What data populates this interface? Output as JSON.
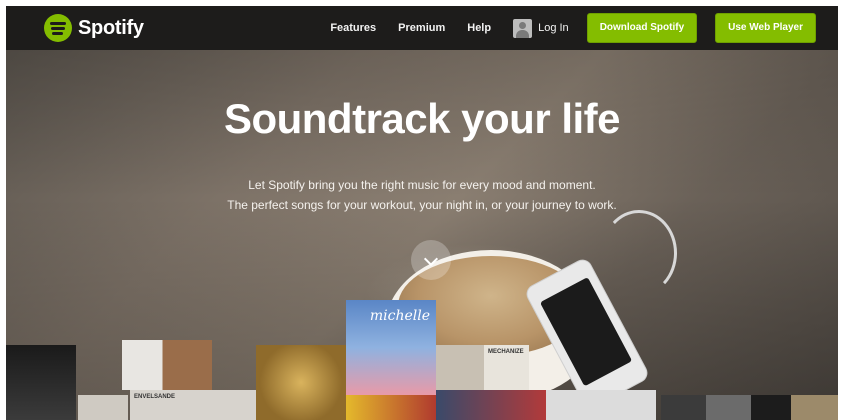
{
  "brand": {
    "name": "Spotify",
    "accent": "#84bd00"
  },
  "nav": {
    "links": [
      "Features",
      "Premium",
      "Help"
    ],
    "login_label": "Log In",
    "download_label": "Download Spotify",
    "webplayer_label": "Use Web Player"
  },
  "hero": {
    "headline": "Soundtrack your life",
    "line1": "Let Spotify bring you the right music for every mood and moment.",
    "line2": "The perfect songs for your workout, your night in, or your journey to work."
  },
  "albums": {
    "michelle": "michelle",
    "ellsande": "ENVELSANDE",
    "mechelte": "MECHANIZE"
  },
  "icons": {
    "logo": "spotify-logo-icon",
    "login": "user-avatar-icon",
    "scroll": "chevron-down-icon"
  }
}
